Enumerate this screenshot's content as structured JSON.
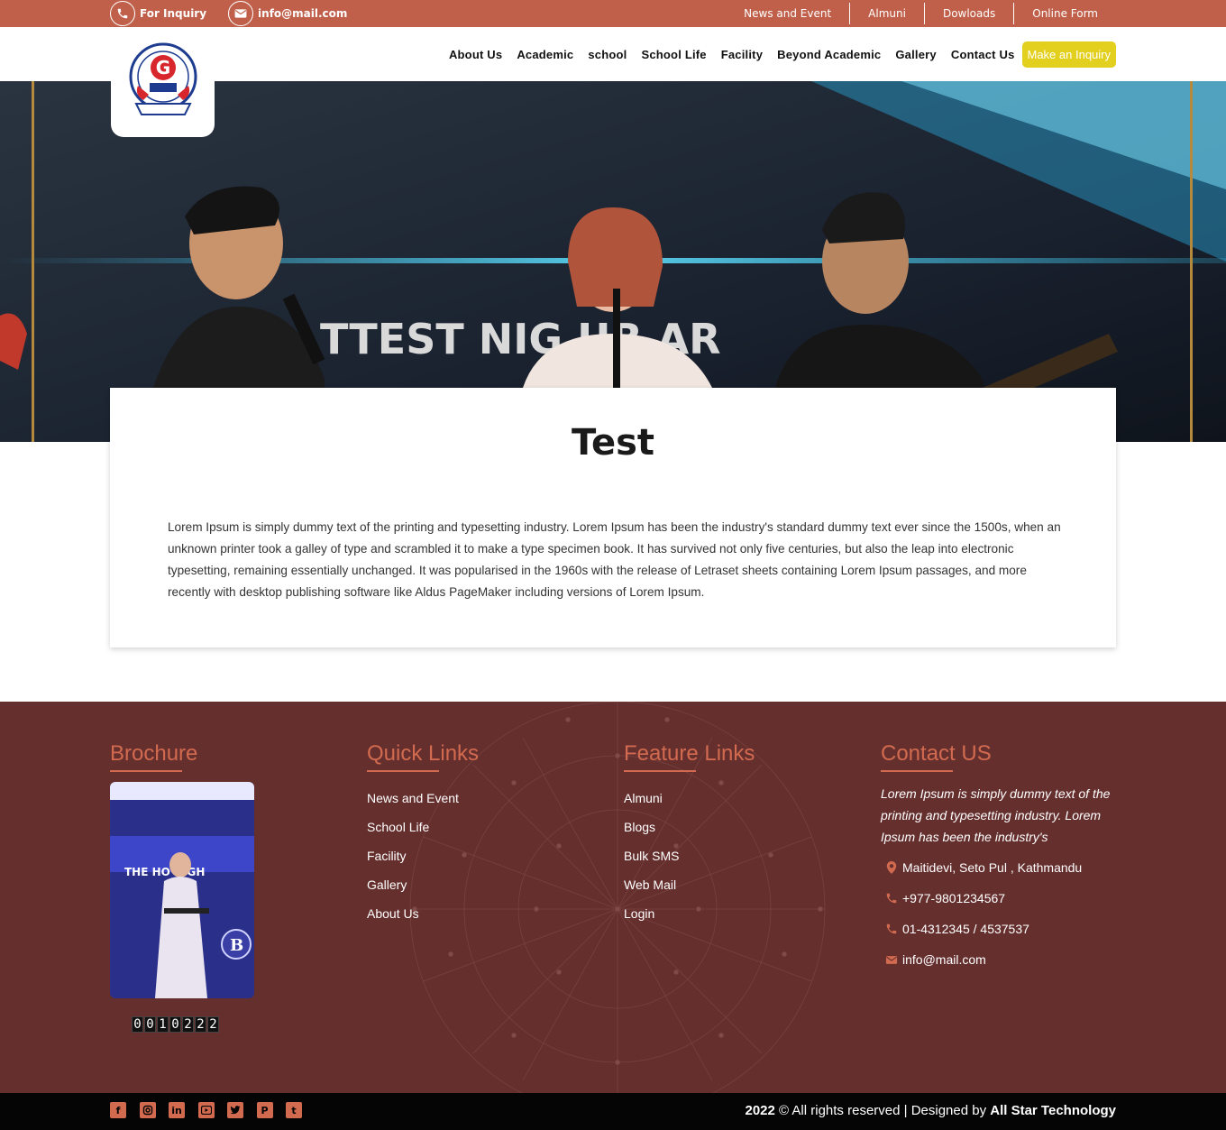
{
  "topbar": {
    "inquiry_label": "For Inquiry",
    "email": "info@mail.com",
    "links": [
      "News and Event",
      "Almuni",
      "Dowloads",
      "Online Form"
    ]
  },
  "nav": {
    "items": [
      "About Us",
      "Academic",
      "school",
      "School Life",
      "Facility",
      "Beyond Academic",
      "Gallery",
      "Contact Us"
    ],
    "cta": "Make an Inquiry"
  },
  "hero": {
    "banner_text": "TTEST NIG   UB AR"
  },
  "content": {
    "title": "Test",
    "body": "Lorem Ipsum is simply dummy text of the printing and typesetting industry. Lorem Ipsum has been the industry's standard dummy text ever since the 1500s, when an unknown printer took a galley of type and scrambled it to make a type specimen book. It has survived not only five centuries, but also the leap into electronic typesetting, remaining essentially unchanged. It was popularised in the 1960s with the release of Letraset sheets containing Lorem Ipsum passages, and more recently with desktop publishing software like Aldus PageMaker including versions of Lorem Ipsum."
  },
  "footer": {
    "brochure": {
      "title": "Brochure",
      "counter": [
        "0",
        "0",
        "1",
        "0",
        "2",
        "2",
        "2"
      ]
    },
    "quick_links": {
      "title": "Quick Links",
      "items": [
        "News and Event",
        "School Life",
        "Facility",
        "Gallery",
        "About Us"
      ]
    },
    "feature_links": {
      "title": "Feature Links",
      "items": [
        "Almuni",
        "Blogs",
        "Bulk SMS",
        "Web Mail",
        "Login"
      ]
    },
    "contact": {
      "title": "Contact US",
      "text": "Lorem Ipsum is simply dummy text of the printing and typesetting industry. Lorem Ipsum has been the industry's",
      "address": "Maitidevi, Seto Pul , Kathmandu",
      "phone1": "+977-9801234567",
      "phone2": "01-4312345 / 4537537",
      "email": "info@mail.com"
    }
  },
  "bottom": {
    "year": "2022",
    "rights": " © All rights reserved | Designed by ",
    "designer": "All Star Technology",
    "socials": [
      "facebook-icon",
      "instagram-icon",
      "linkedin-icon",
      "youtube-icon",
      "twitter-icon",
      "pinterest-icon",
      "tumblr-icon"
    ]
  },
  "colors": {
    "topbar": "#c0604a",
    "accent": "#d26a4f",
    "cta": "#e3cf1d",
    "footer": "#652f2e",
    "bottombar": "#050505"
  }
}
